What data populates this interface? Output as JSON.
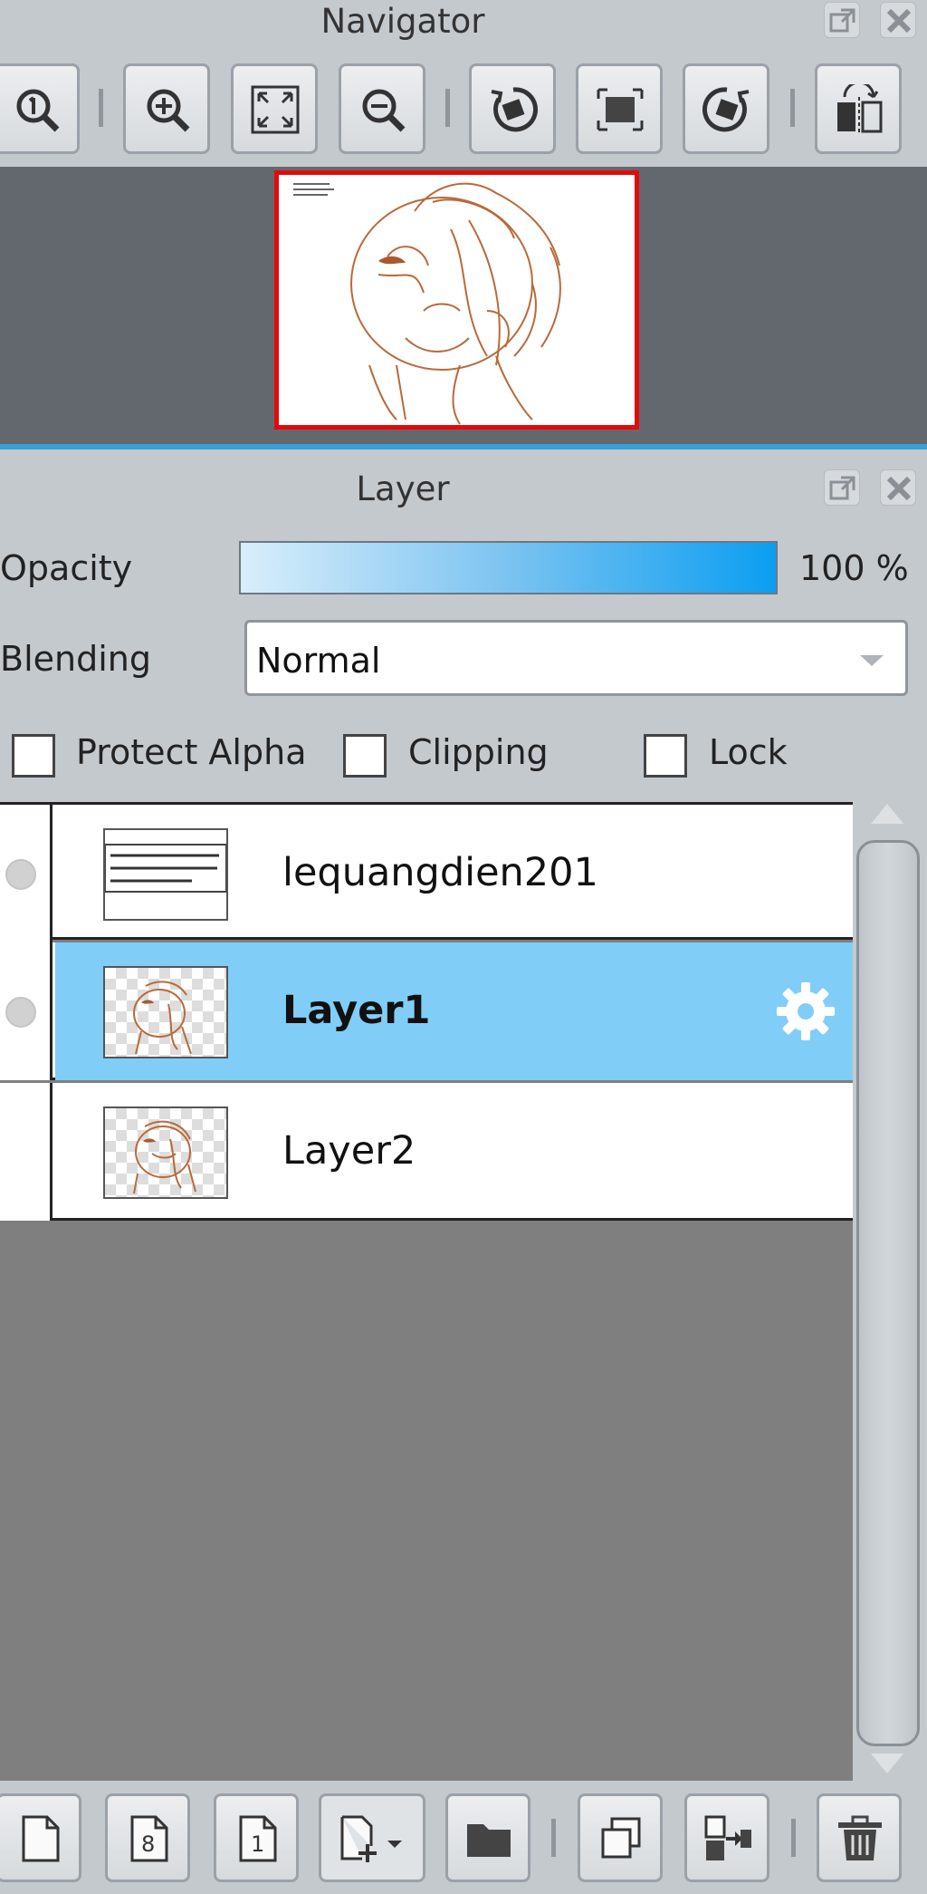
{
  "navigator": {
    "title": "Navigator",
    "toolbar": [
      {
        "name": "zoom-actual-size",
        "icon": "zoom-1-icon"
      },
      {
        "name": "zoom-in",
        "icon": "zoom-in-icon"
      },
      {
        "name": "fit-to-window",
        "icon": "fit-window-icon"
      },
      {
        "name": "zoom-out",
        "icon": "zoom-out-icon"
      },
      {
        "name": "rotate-left",
        "icon": "rotate-left-icon"
      },
      {
        "name": "reset-view",
        "icon": "reset-view-icon"
      },
      {
        "name": "rotate-right",
        "icon": "rotate-right-icon"
      },
      {
        "name": "flip-horizontal",
        "icon": "flip-icon"
      }
    ],
    "thumbnail_border_color": "#e30a0a"
  },
  "layer_panel": {
    "title": "Layer",
    "opacity_label": "Opacity",
    "opacity_value": "100 %",
    "opacity_fraction": 1.0,
    "blending_label": "Blending",
    "blending_value": "Normal",
    "checkboxes": {
      "protect_alpha": {
        "label": "Protect Alpha",
        "checked": false
      },
      "clipping": {
        "label": "Clipping",
        "checked": false
      },
      "lock": {
        "label": "Lock",
        "checked": false
      }
    },
    "layers": [
      {
        "name": "lequangdien201",
        "visible": true,
        "selected": false
      },
      {
        "name": "Layer1",
        "visible": true,
        "selected": true
      },
      {
        "name": "Layer2",
        "visible": false,
        "selected": false
      }
    ],
    "accent_color": "#80cef7"
  },
  "bottom_toolbar": [
    {
      "name": "new-layer",
      "icon": "new-page-icon"
    },
    {
      "name": "new-8bit-layer",
      "icon": "new-8bit-layer-icon",
      "badge": "8"
    },
    {
      "name": "new-1bit-layer",
      "icon": "new-1bit-layer-icon",
      "badge": "1"
    },
    {
      "name": "add-layer-menu",
      "icon": "add-layer-dropdown-icon"
    },
    {
      "name": "new-folder",
      "icon": "folder-icon"
    },
    {
      "name": "duplicate-layer",
      "icon": "duplicate-icon"
    },
    {
      "name": "merge-down",
      "icon": "merge-down-icon"
    },
    {
      "name": "delete-layer",
      "icon": "trash-icon"
    }
  ]
}
